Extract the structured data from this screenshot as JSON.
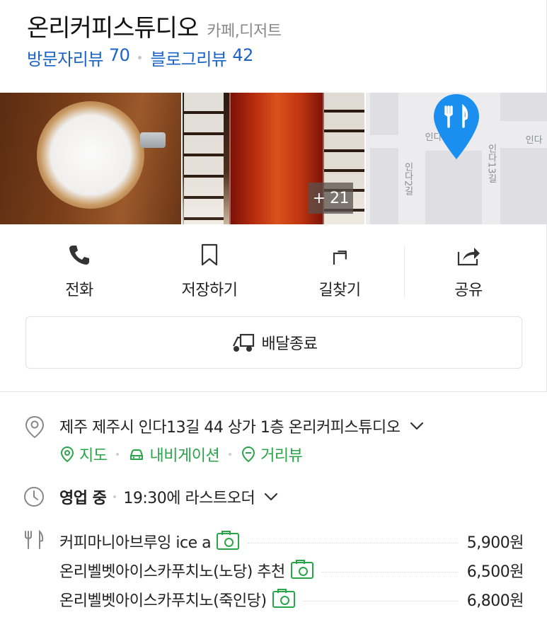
{
  "place": {
    "name": "온리커피스튜디오",
    "category": "카페,디저트"
  },
  "reviews": {
    "visit_label": "방문자리뷰",
    "visit_count": "70",
    "blog_label": "블로그리뷰",
    "blog_count": "42"
  },
  "photos": {
    "more_count": "+ 21"
  },
  "map": {
    "labels": [
      "인다",
      "인다",
      "인다2길",
      "인다13길"
    ]
  },
  "actions": [
    {
      "label": "전화",
      "icon": "phone-icon"
    },
    {
      "label": "저장하기",
      "icon": "bookmark-icon"
    },
    {
      "label": "길찾기",
      "icon": "directions-icon"
    },
    {
      "label": "공유",
      "icon": "share-icon"
    }
  ],
  "delivery": {
    "label": "배달종료",
    "icon": "delivery-scooter-icon"
  },
  "address": {
    "text": "제주 제주시 인다13길 44 상가 1층 온리커피스튜디오"
  },
  "links": {
    "map": "지도",
    "navigation": "내비게이션",
    "street_view": "거리뷰"
  },
  "hours": {
    "status": "영업 중",
    "detail": "19:30에 라스트오더"
  },
  "menu": [
    {
      "name": "커피마니아브루잉 ice a",
      "price": "5,900원",
      "has_photo": true
    },
    {
      "name": "온리벨벳아이스카푸치노(노당) 추천",
      "price": "6,500원",
      "has_photo": true
    },
    {
      "name": "온리벨벳아이스카푸치노(죽인당)",
      "price": "6,800원",
      "has_photo": true
    }
  ],
  "colors": {
    "link_blue": "#1a64c8",
    "accent_green": "#29a449",
    "pin_blue": "#1a8ff0"
  }
}
